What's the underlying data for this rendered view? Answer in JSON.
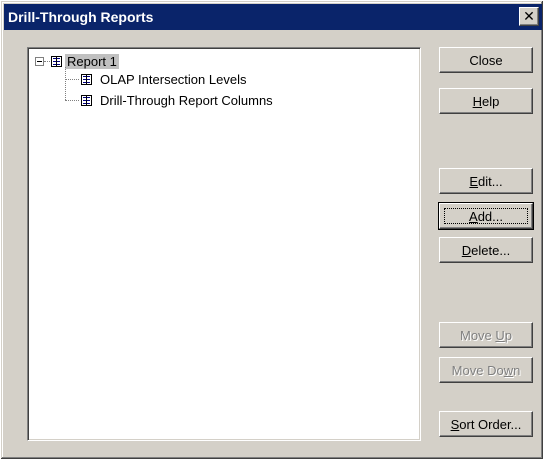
{
  "window": {
    "title": "Drill-Through Reports",
    "close_glyph": "✕"
  },
  "tree": {
    "root": {
      "label": "Report 1",
      "icon": "report-icon",
      "expanded": true,
      "selected": true
    },
    "children": [
      {
        "label": "OLAP Intersection Levels",
        "icon": "table-icon"
      },
      {
        "label": "Drill-Through Report Columns",
        "icon": "table-icon"
      }
    ]
  },
  "buttons": {
    "close": {
      "pre": "",
      "key": "",
      "post": "Close",
      "enabled": true
    },
    "help": {
      "pre": "",
      "key": "H",
      "post": "elp",
      "enabled": true
    },
    "edit": {
      "pre": "",
      "key": "E",
      "post": "dit...",
      "enabled": true
    },
    "add": {
      "pre": "",
      "key": "A",
      "post": "dd...",
      "enabled": true,
      "default": true
    },
    "delete": {
      "pre": "",
      "key": "D",
      "post": "elete...",
      "enabled": true
    },
    "move_up": {
      "pre": "Move ",
      "key": "U",
      "post": "p",
      "enabled": false
    },
    "move_down": {
      "pre": "Move Do",
      "key": "w",
      "post": "n",
      "enabled": false
    },
    "sort_order": {
      "pre": "",
      "key": "S",
      "post": "ort Order...",
      "enabled": true
    }
  },
  "colors": {
    "title_bar": "#0a246a",
    "face": "#d4d0c8",
    "selection": "#c0c0c0",
    "disabled_text": "#808080"
  }
}
